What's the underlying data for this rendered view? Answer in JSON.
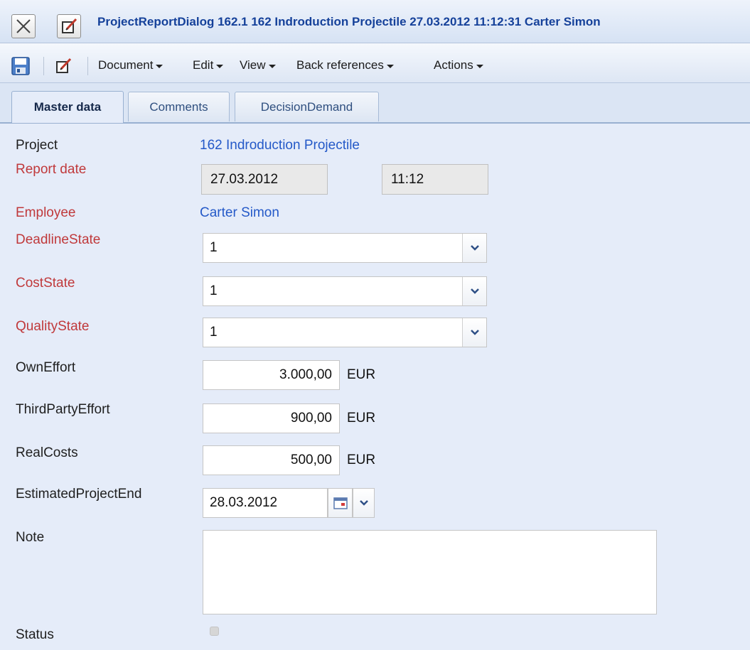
{
  "window": {
    "title": "ProjectReportDialog 162.1 162 Indroduction Projectile 27.03.2012 11:12:31 Carter Simon",
    "close_icon": "close-x-icon",
    "edit_icon": "edit-document-icon"
  },
  "toolbar": {
    "save_icon": "floppy-disk-icon",
    "edit_icon": "edit-document-icon",
    "menus": [
      "Document",
      "Edit",
      "View",
      "Back references",
      "Actions"
    ]
  },
  "tabs": [
    {
      "label": "Master data",
      "active": true
    },
    {
      "label": "Comments",
      "active": false
    },
    {
      "label": "DecisionDemand",
      "active": false
    }
  ],
  "form": {
    "project": {
      "label": "Project",
      "value": "162 Indroduction Projectile"
    },
    "report_date": {
      "label": "Report date",
      "date": "27.03.2012",
      "time": "11:12"
    },
    "employee": {
      "label": "Employee",
      "value": "Carter Simon"
    },
    "deadline_state": {
      "label": "DeadlineState",
      "value": "1"
    },
    "cost_state": {
      "label": "CostState",
      "value": "1"
    },
    "quality_state": {
      "label": "QualityState",
      "value": "1"
    },
    "own_effort": {
      "label": "OwnEffort",
      "value": "3.000,00",
      "unit": "EUR"
    },
    "third_party_effort": {
      "label": "ThirdPartyEffort",
      "value": "900,00",
      "unit": "EUR"
    },
    "real_costs": {
      "label": "RealCosts",
      "value": "500,00",
      "unit": "EUR"
    },
    "estimated_project_end": {
      "label": "EstimatedProjectEnd",
      "value": "28.03.2012"
    },
    "note": {
      "label": "Note",
      "value": ""
    },
    "status": {
      "label": "Status",
      "checked": false
    }
  },
  "colors": {
    "background": "#e5ecf9",
    "title_text": "#15419a",
    "required_label": "#c0393b",
    "link_value": "#2459c8"
  }
}
